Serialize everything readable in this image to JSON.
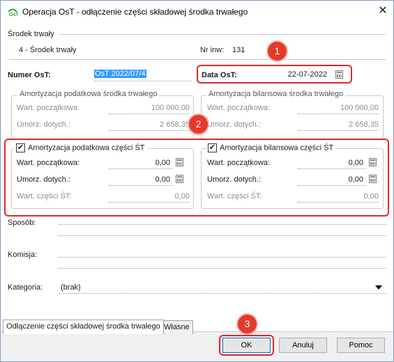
{
  "window": {
    "title": "Operacja OsT - odłączenie części składowej środka trwałego",
    "close_glyph": "✕"
  },
  "asset": {
    "section_label": "Środek trwały",
    "name": "4 - Środek trwały",
    "inv_label": "Nr inw:",
    "inv_value": "131"
  },
  "operation": {
    "number_label": "Numer OsT:",
    "number_value": "OsT 2022/07/4",
    "date_label": "Data OsT:",
    "date_value": "22-07-2022"
  },
  "asset_tax": {
    "title": "Amortyzacja podatkowa środka trwałego",
    "initial_label": "Wart. początkowa:",
    "initial_value": "100 000,00",
    "redemption_label": "Umorz. dotych.:",
    "redemption_value": "2 658,35"
  },
  "asset_balance": {
    "title": "Amortyzacja bilansowa środka trwałego",
    "initial_label": "Wart. początkowa:",
    "initial_value": "100 000,00",
    "redemption_label": "Umorz. dotych.:",
    "redemption_value": "2 658,35"
  },
  "part_tax": {
    "title": "Amortyzacja podatkowa części ŚT",
    "checked": true,
    "check_glyph": "✔",
    "initial_label": "Wart. początkowa:",
    "initial_value": "0,00",
    "redemption_label": "Umorz. dotych.:",
    "redemption_value": "0,00",
    "part_value_label": "Wart. części ŚT:",
    "part_value": "0,00"
  },
  "part_balance": {
    "title": "Amortyzacja bilansowa części ŚT",
    "checked": true,
    "check_glyph": "✔",
    "initial_label": "Wart. początkowa:",
    "initial_value": "0,00",
    "redemption_label": "Umorz. dotych.:",
    "redemption_value": "0,00",
    "part_value_label": "Wart. części ŚT:",
    "part_value": "0,00"
  },
  "fields": {
    "method_label": "Sposób:",
    "committee_label": "Komisja:",
    "category_label": "Kategoria:",
    "category_value": "(brak)"
  },
  "tabs": [
    {
      "label": "Odłączenie części składowej środka trwałego"
    },
    {
      "label": "Własne"
    }
  ],
  "buttons": {
    "ok": "OK",
    "cancel": "Anuluj",
    "help": "Pomoc"
  },
  "badges": [
    "1",
    "2",
    "3"
  ],
  "colors": {
    "highlight_red": "#e32626",
    "badge_red": "#e33a2c",
    "selection_blue": "#3399ff"
  }
}
